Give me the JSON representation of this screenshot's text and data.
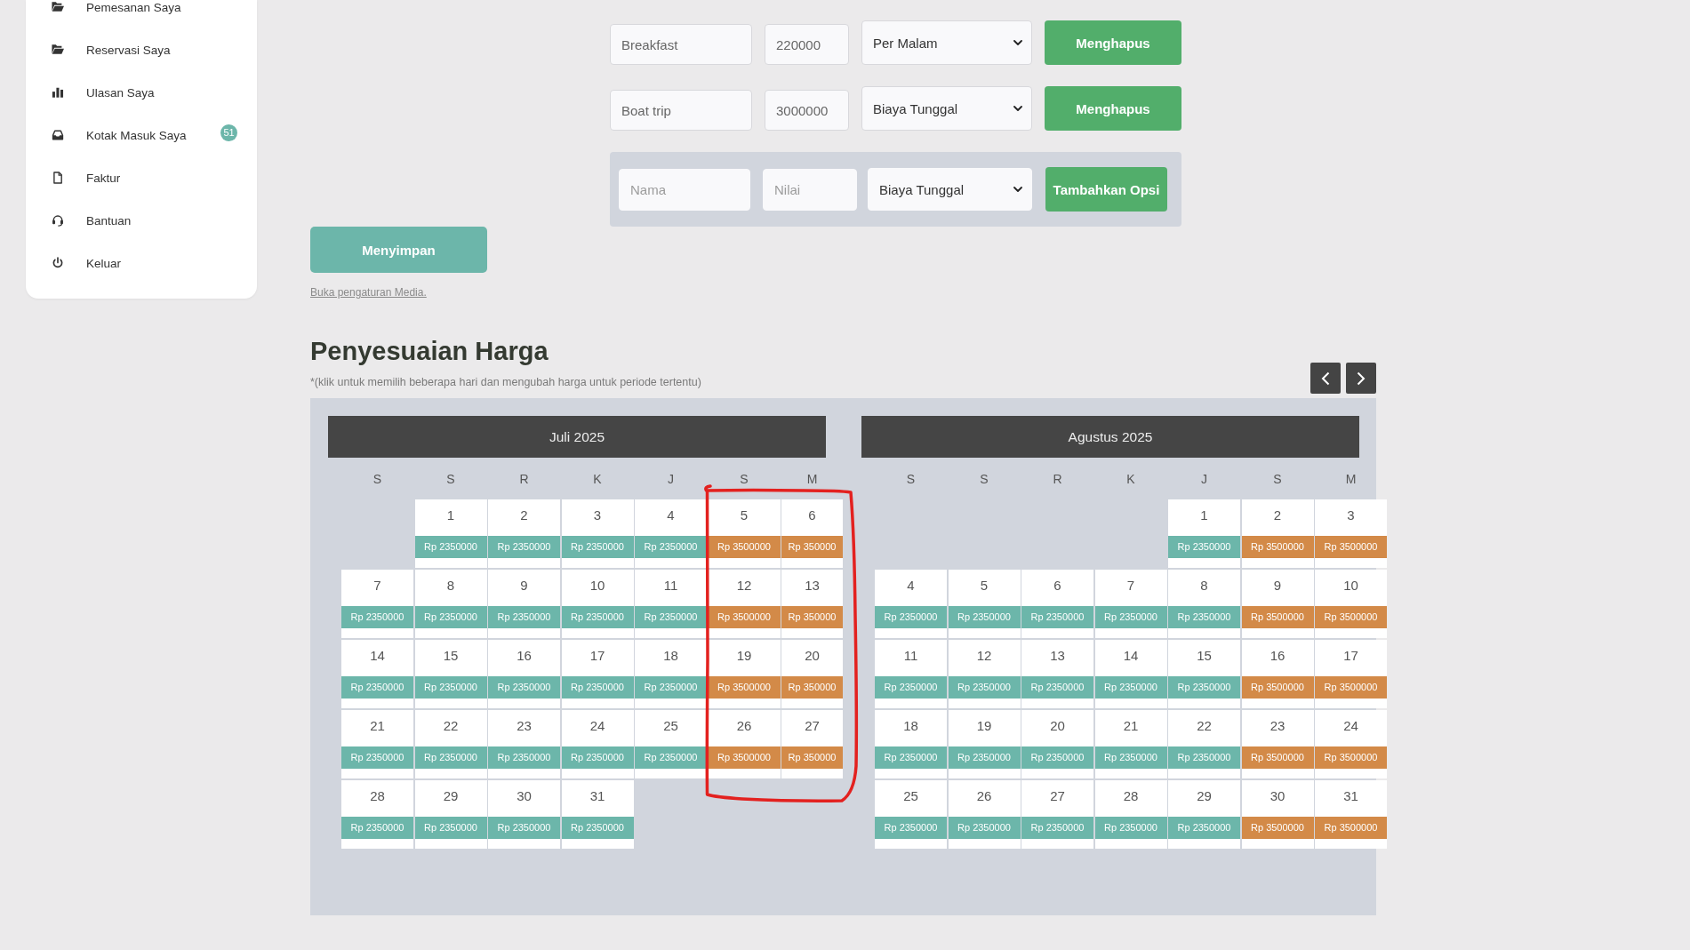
{
  "sidebar": {
    "items": [
      {
        "label": "Pemesanan Saya",
        "selected": false
      },
      {
        "label": "Reservasi Saya",
        "selected": false
      },
      {
        "label": "Ulasan Saya",
        "selected": false
      },
      {
        "label": "Kotak Masuk Saya",
        "badge": "51",
        "selected": false
      },
      {
        "label": "Faktur",
        "selected": false
      },
      {
        "label": "Bantuan",
        "selected": false
      },
      {
        "label": "Keluar",
        "selected": false
      }
    ]
  },
  "extra_options": {
    "rows": [
      {
        "name": "Breakfast",
        "value": "220000",
        "charge": "Per Malam",
        "button": "Menghapus"
      },
      {
        "name": "Boat trip",
        "value": "3000000",
        "charge": "Biaya Tunggal",
        "button": "Menghapus"
      }
    ],
    "new_option": {
      "name_field": {
        "placeholder": "Nama"
      },
      "value_field": {
        "placeholder": "Nilai"
      },
      "charge": "Biaya Tunggal",
      "button": "Tambahkan Opsi"
    }
  },
  "save_button": "Menyimpan",
  "media_link": "Buka pengaturan Media.",
  "pricing": {
    "title": "Penyesuaian Harga",
    "note": "*(klik untuk memilih beberapa hari dan mengubah harga untuk periode tertentu)",
    "annotation": {
      "kind": "freehand-outline"
    },
    "months": [
      {
        "title": "Juli 2025",
        "weekdays": [
          "S",
          "S",
          "R",
          "K",
          "J",
          "S",
          "M"
        ],
        "weeks": [
          [
            {
              "kind": "blank"
            },
            {
              "kind": "day",
              "day": "1",
              "price": "Rp 2350000",
              "color": "#6cb6aa"
            },
            {
              "kind": "day",
              "day": "2",
              "price": "Rp 2350000",
              "color": "#6cb6aa"
            },
            {
              "kind": "day",
              "day": "3",
              "price": "Rp 2350000",
              "color": "#6cb6aa"
            },
            {
              "kind": "day",
              "day": "4",
              "price": "Rp 2350000",
              "color": "#6cb6aa"
            },
            {
              "kind": "day",
              "day": "5",
              "price": "Rp 3500000",
              "color": "#d38a48"
            },
            {
              "kind": "day",
              "day": "6",
              "price": "Rp 350000",
              "color": "#d38a48"
            }
          ],
          [
            {
              "kind": "day",
              "day": "7",
              "price": "Rp 2350000",
              "color": "#6cb6aa"
            },
            {
              "kind": "day",
              "day": "8",
              "price": "Rp 2350000",
              "color": "#6cb6aa"
            },
            {
              "kind": "day",
              "day": "9",
              "price": "Rp 2350000",
              "color": "#6cb6aa"
            },
            {
              "kind": "day",
              "day": "10",
              "price": "Rp 2350000",
              "color": "#6cb6aa"
            },
            {
              "kind": "day",
              "day": "11",
              "price": "Rp 2350000",
              "color": "#6cb6aa"
            },
            {
              "kind": "day",
              "day": "12",
              "price": "Rp 3500000",
              "color": "#d38a48"
            },
            {
              "kind": "day",
              "day": "13",
              "price": "Rp 350000",
              "color": "#d38a48"
            }
          ],
          [
            {
              "kind": "day",
              "day": "14",
              "price": "Rp 2350000",
              "color": "#6cb6aa"
            },
            {
              "kind": "day",
              "day": "15",
              "price": "Rp 2350000",
              "color": "#6cb6aa"
            },
            {
              "kind": "day",
              "day": "16",
              "price": "Rp 2350000",
              "color": "#6cb6aa"
            },
            {
              "kind": "day",
              "day": "17",
              "price": "Rp 2350000",
              "color": "#6cb6aa"
            },
            {
              "kind": "day",
              "day": "18",
              "price": "Rp 2350000",
              "color": "#6cb6aa"
            },
            {
              "kind": "day",
              "day": "19",
              "price": "Rp 3500000",
              "color": "#d38a48"
            },
            {
              "kind": "day",
              "day": "20",
              "price": "Rp 350000",
              "color": "#d38a48"
            }
          ],
          [
            {
              "kind": "day",
              "day": "21",
              "price": "Rp 2350000",
              "color": "#6cb6aa"
            },
            {
              "kind": "day",
              "day": "22",
              "price": "Rp 2350000",
              "color": "#6cb6aa"
            },
            {
              "kind": "day",
              "day": "23",
              "price": "Rp 2350000",
              "color": "#6cb6aa"
            },
            {
              "kind": "day",
              "day": "24",
              "price": "Rp 2350000",
              "color": "#6cb6aa"
            },
            {
              "kind": "day",
              "day": "25",
              "price": "Rp 2350000",
              "color": "#6cb6aa"
            },
            {
              "kind": "day",
              "day": "26",
              "price": "Rp 3500000",
              "color": "#d38a48"
            },
            {
              "kind": "day",
              "day": "27",
              "price": "Rp 350000",
              "color": "#d38a48"
            }
          ],
          [
            {
              "kind": "day",
              "day": "28",
              "price": "Rp 2350000",
              "color": "#6cb6aa"
            },
            {
              "kind": "day",
              "day": "29",
              "price": "Rp 2350000",
              "color": "#6cb6aa"
            },
            {
              "kind": "day",
              "day": "30",
              "price": "Rp 2350000",
              "color": "#6cb6aa"
            },
            {
              "kind": "day",
              "day": "31",
              "price": "Rp 2350000",
              "color": "#6cb6aa"
            }
          ]
        ]
      },
      {
        "title": "Agustus 2025",
        "weekdays": [
          "S",
          "S",
          "R",
          "K",
          "J",
          "S",
          "M"
        ],
        "weeks": [
          [
            {
              "kind": "blank"
            },
            {
              "kind": "blank"
            },
            {
              "kind": "blank"
            },
            {
              "kind": "blank"
            },
            {
              "kind": "day",
              "day": "1",
              "price": "Rp 2350000",
              "color": "#6cb6aa"
            },
            {
              "kind": "day",
              "day": "2",
              "price": "Rp 3500000",
              "color": "#d38a48"
            },
            {
              "kind": "day",
              "day": "3",
              "price": "Rp 3500000",
              "color": "#d38a48"
            }
          ],
          [
            {
              "kind": "day",
              "day": "4",
              "price": "Rp 2350000",
              "color": "#6cb6aa"
            },
            {
              "kind": "day",
              "day": "5",
              "price": "Rp 2350000",
              "color": "#6cb6aa"
            },
            {
              "kind": "day",
              "day": "6",
              "price": "Rp 2350000",
              "color": "#6cb6aa"
            },
            {
              "kind": "day",
              "day": "7",
              "price": "Rp 2350000",
              "color": "#6cb6aa"
            },
            {
              "kind": "day",
              "day": "8",
              "price": "Rp 2350000",
              "color": "#6cb6aa"
            },
            {
              "kind": "day",
              "day": "9",
              "price": "Rp 3500000",
              "color": "#d38a48"
            },
            {
              "kind": "day",
              "day": "10",
              "price": "Rp 3500000",
              "color": "#d38a48"
            }
          ],
          [
            {
              "kind": "day",
              "day": "11",
              "price": "Rp 2350000",
              "color": "#6cb6aa"
            },
            {
              "kind": "day",
              "day": "12",
              "price": "Rp 2350000",
              "color": "#6cb6aa"
            },
            {
              "kind": "day",
              "day": "13",
              "price": "Rp 2350000",
              "color": "#6cb6aa"
            },
            {
              "kind": "day",
              "day": "14",
              "price": "Rp 2350000",
              "color": "#6cb6aa"
            },
            {
              "kind": "day",
              "day": "15",
              "price": "Rp 2350000",
              "color": "#6cb6aa"
            },
            {
              "kind": "day",
              "day": "16",
              "price": "Rp 3500000",
              "color": "#d38a48"
            },
            {
              "kind": "day",
              "day": "17",
              "price": "Rp 3500000",
              "color": "#d38a48"
            }
          ],
          [
            {
              "kind": "day",
              "day": "18",
              "price": "Rp 2350000",
              "color": "#6cb6aa"
            },
            {
              "kind": "day",
              "day": "19",
              "price": "Rp 2350000",
              "color": "#6cb6aa"
            },
            {
              "kind": "day",
              "day": "20",
              "price": "Rp 2350000",
              "color": "#6cb6aa"
            },
            {
              "kind": "day",
              "day": "21",
              "price": "Rp 2350000",
              "color": "#6cb6aa"
            },
            {
              "kind": "day",
              "day": "22",
              "price": "Rp 2350000",
              "color": "#6cb6aa"
            },
            {
              "kind": "day",
              "day": "23",
              "price": "Rp 3500000",
              "color": "#d38a48"
            },
            {
              "kind": "day",
              "day": "24",
              "price": "Rp 3500000",
              "color": "#d38a48"
            }
          ],
          [
            {
              "kind": "day",
              "day": "25",
              "price": "Rp 2350000",
              "color": "#6cb6aa"
            },
            {
              "kind": "day",
              "day": "26",
              "price": "Rp 2350000",
              "color": "#6cb6aa"
            },
            {
              "kind": "day",
              "day": "27",
              "price": "Rp 2350000",
              "color": "#6cb6aa"
            },
            {
              "kind": "day",
              "day": "28",
              "price": "Rp 2350000",
              "color": "#6cb6aa"
            },
            {
              "kind": "day",
              "day": "29",
              "price": "Rp 2350000",
              "color": "#6cb6aa"
            },
            {
              "kind": "day",
              "day": "30",
              "price": "Rp 3500000",
              "color": "#d38a48"
            },
            {
              "kind": "day",
              "day": "31",
              "price": "Rp 3500000",
              "color": "#d38a48"
            }
          ]
        ]
      }
    ]
  }
}
